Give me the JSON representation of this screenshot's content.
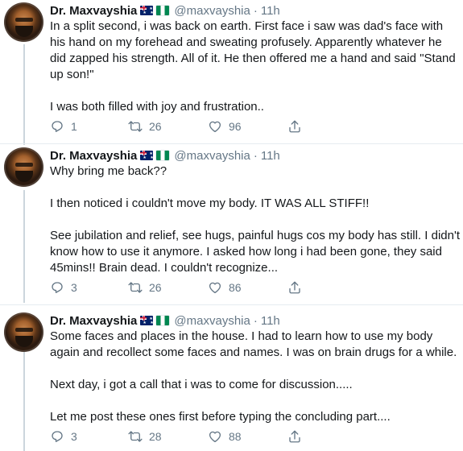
{
  "tweets": [
    {
      "author": "Dr. Maxvayshia",
      "handle": "@maxvayshia",
      "separator": "·",
      "time": "11h",
      "paragraphs": [
        "In a split second, i was back on earth. First face i saw was dad's face with his hand on my forehead and sweating profusely. Apparently whatever he did zapped his strength. All of it. He then offered me a hand and said \"Stand up son!\"",
        "I was both filled with joy and frustration.."
      ],
      "replies": "1",
      "retweets": "26",
      "likes": "96"
    },
    {
      "author": "Dr. Maxvayshia",
      "handle": "@maxvayshia",
      "separator": "·",
      "time": "11h",
      "paragraphs": [
        "Why bring me back??",
        "I then noticed i couldn't move my body. IT WAS ALL STIFF!!",
        "See jubilation and relief, see hugs, painful hugs cos my body has still. I didn't know how to use it anymore. I asked how long i had been gone, they said 45mins!! Brain dead. I couldn't recognize..."
      ],
      "replies": "3",
      "retweets": "26",
      "likes": "86"
    },
    {
      "author": "Dr. Maxvayshia",
      "handle": "@maxvayshia",
      "separator": "·",
      "time": "11h",
      "paragraphs": [
        "Some faces and places in the house. I had to learn how to use my body again and recollect some faces and names. I was on brain drugs for a while.",
        "Next day, i got a call that i was to come for discussion.....",
        "Let me post these ones first before typing the concluding part...."
      ],
      "replies": "3",
      "retweets": "28",
      "likes": "88"
    }
  ],
  "icons": {
    "reply": "reply-icon",
    "retweet": "retweet-icon",
    "like": "heart-icon",
    "share": "share-icon",
    "flags": [
      "australia-flag-icon",
      "nigeria-flag-icon"
    ]
  },
  "colors": {
    "text": "#14171a",
    "secondary": "#657786",
    "thread_line": "#ccd6dd",
    "divider": "#e6ecf0"
  }
}
